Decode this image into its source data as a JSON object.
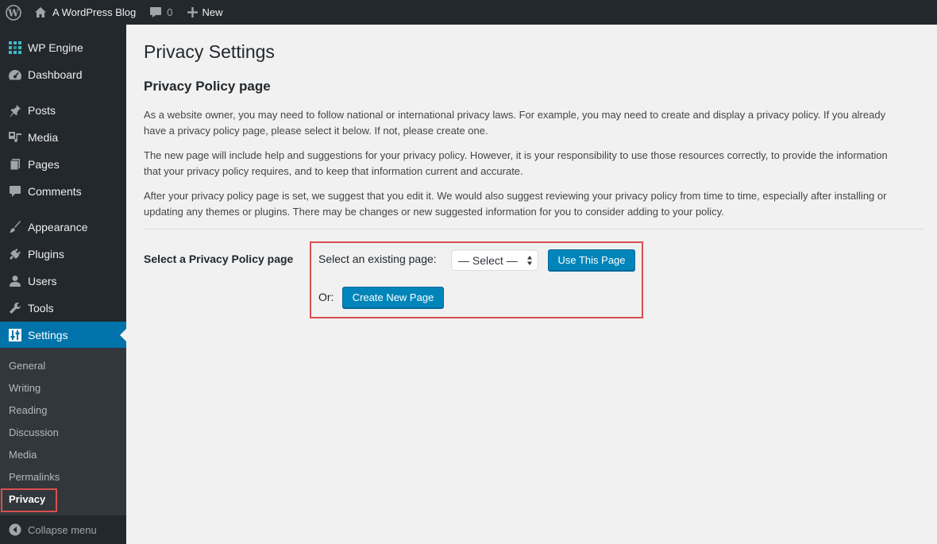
{
  "admin_bar": {
    "wp_logo_icon": "wordpress-logo-icon",
    "site_name": "A WordPress Blog",
    "comments_count": "0",
    "new_label": "New"
  },
  "sidebar": {
    "items": [
      {
        "label": "WP Engine",
        "icon": "wp-engine-icon"
      },
      {
        "label": "Dashboard",
        "icon": "dashboard-icon"
      },
      {
        "label": "Posts",
        "icon": "pushpin-icon"
      },
      {
        "label": "Media",
        "icon": "media-icon"
      },
      {
        "label": "Pages",
        "icon": "pages-icon"
      },
      {
        "label": "Comments",
        "icon": "comment-icon"
      },
      {
        "label": "Appearance",
        "icon": "paintbrush-icon"
      },
      {
        "label": "Plugins",
        "icon": "plugin-icon"
      },
      {
        "label": "Users",
        "icon": "user-icon"
      },
      {
        "label": "Tools",
        "icon": "wrench-icon"
      },
      {
        "label": "Settings",
        "icon": "settings-icon"
      }
    ],
    "submenu": [
      "General",
      "Writing",
      "Reading",
      "Discussion",
      "Media",
      "Permalinks",
      "Privacy"
    ],
    "collapse_label": "Collapse menu"
  },
  "main": {
    "page_title": "Privacy Settings",
    "section_title": "Privacy Policy page",
    "paragraphs": [
      "As a website owner, you may need to follow national or international privacy laws. For example, you may need to create and display a privacy policy. If you already have a privacy policy page, please select it below. If not, please create one.",
      "The new page will include help and suggestions for your privacy policy. However, it is your responsibility to use those resources correctly, to provide the information that your privacy policy requires, and to keep that information current and accurate.",
      "After your privacy policy page is set, we suggest that you edit it. We would also suggest reviewing your privacy policy from time to time, especially after installing or updating any themes or plugins. There may be changes or new suggested information for you to consider adding to your policy."
    ],
    "row_label": "Select a Privacy Policy page",
    "existing_label": "Select an existing page:",
    "select_value": "— Select —",
    "use_button": "Use This Page",
    "or_label": "Or:",
    "create_button": "Create New Page"
  },
  "colors": {
    "admin_bg": "#23282d",
    "submenu_bg": "#32373c",
    "accent": "#0073aa",
    "button": "#0085ba",
    "highlight": "#dc4f4f"
  }
}
